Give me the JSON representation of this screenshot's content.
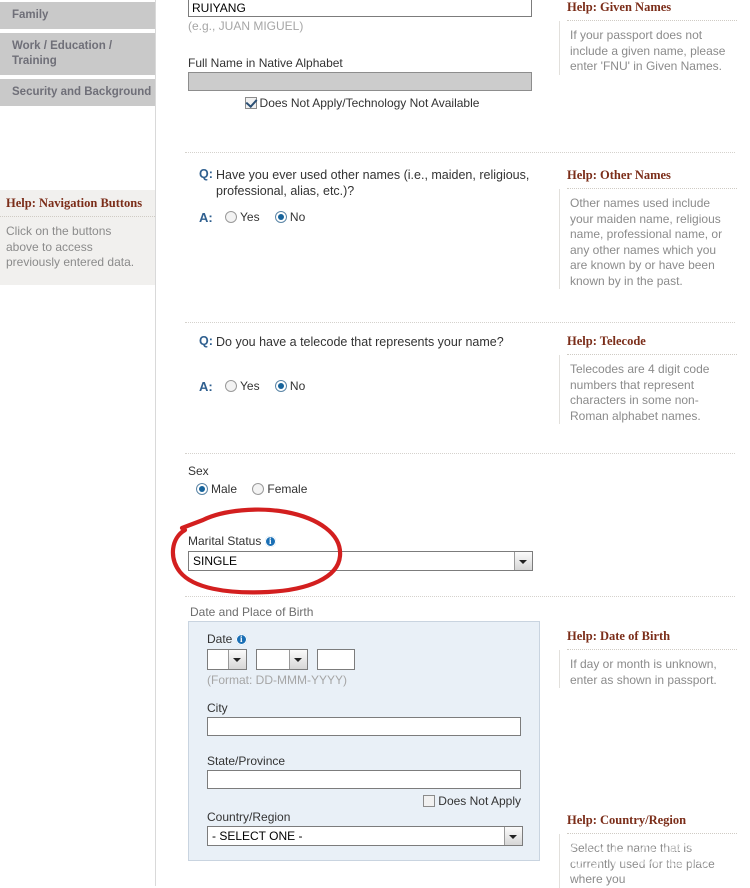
{
  "sidebar": {
    "nav_items": [
      {
        "label": "Family"
      },
      {
        "label": "Work / Education / Training"
      },
      {
        "label": "Security and Background"
      }
    ],
    "help": {
      "title": "Help: Navigation Buttons",
      "body": "Click on the buttons above to access previously entered data."
    }
  },
  "form": {
    "given_names": {
      "value": "RUIYANG",
      "example": "(e.g., JUAN MIGUEL)"
    },
    "native_alphabet": {
      "label": "Full Name in Native Alphabet",
      "value": "",
      "does_not_apply_label": "Does Not Apply/Technology Not Available",
      "does_not_apply_checked": true
    },
    "other_names": {
      "q_prefix": "Q:",
      "question": "Have you ever used other names (i.e., maiden, religious, professional, alias, etc.)?",
      "a_prefix": "A:",
      "yes_label": "Yes",
      "no_label": "No",
      "selected": "No"
    },
    "telecode": {
      "q_prefix": "Q:",
      "question": "Do you have a telecode that represents your name?",
      "a_prefix": "A:",
      "yes_label": "Yes",
      "no_label": "No",
      "selected": "No"
    },
    "sex": {
      "label": "Sex",
      "male_label": "Male",
      "female_label": "Female",
      "selected": "Male"
    },
    "marital_status": {
      "label": "Marital Status",
      "info_glyph": "i",
      "value": "SINGLE"
    },
    "birth": {
      "legend": "Date and Place of Birth",
      "date_label": "Date",
      "date_info_glyph": "i",
      "day_value": "",
      "month_value": "",
      "year_value": "",
      "format_hint": "(Format: DD-MMM-YYYY)",
      "city_label": "City",
      "city_value": "",
      "state_label": "State/Province",
      "state_value": "",
      "state_does_not_apply_label": "Does Not Apply",
      "state_does_not_apply_checked": false,
      "country_label": "Country/Region",
      "country_value": "- SELECT ONE -"
    }
  },
  "help_panels": [
    {
      "title": "Help: Given Names",
      "body": "If your passport does not include a given name, please enter 'FNU' in Given Names."
    },
    {
      "title": "Help: Other Names",
      "body": "Other names used include your maiden name, religious name, professional name, or any other names which you are known by or have been known by in the past."
    },
    {
      "title": "Help: Telecode",
      "body": "Telecodes are 4 digit code numbers that represent characters in some non-Roman alphabet names."
    },
    {
      "title": "Help: Date of Birth",
      "body": "If day or month is unknown, enter as shown in passport."
    },
    {
      "title": "Help: Country/Region",
      "body": "Select the name that is currently used for the place where you"
    }
  ],
  "annotation": {
    "shape": "red-ellipse-circle",
    "color": "#d31f1f",
    "target": "Marital Status"
  },
  "watermark": {
    "text": "什么值得买",
    "color": "#ffffff"
  }
}
